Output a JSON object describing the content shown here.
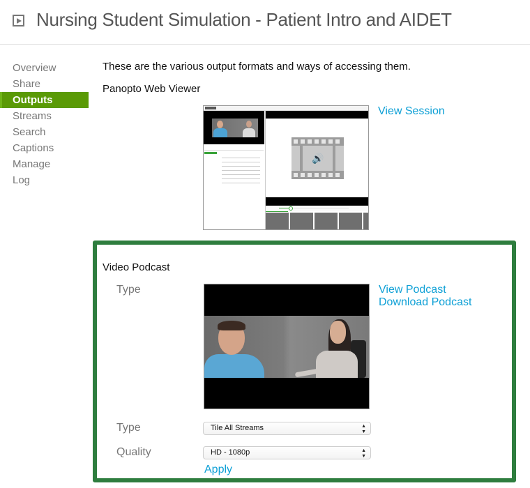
{
  "header": {
    "icon": "play-box-icon",
    "title": "Nursing Student Simulation - Patient Intro and AIDET"
  },
  "sidebar": {
    "items": [
      {
        "label": "Overview",
        "active": false
      },
      {
        "label": "Share",
        "active": false
      },
      {
        "label": "Outputs",
        "active": true
      },
      {
        "label": "Streams",
        "active": false
      },
      {
        "label": "Search",
        "active": false
      },
      {
        "label": "Captions",
        "active": false
      },
      {
        "label": "Manage",
        "active": false
      },
      {
        "label": "Log",
        "active": false
      }
    ]
  },
  "main": {
    "intro": "These are the various output formats and ways of accessing them.",
    "web_viewer": {
      "title": "Panopto Web Viewer",
      "thumbnail": "web-viewer-preview-image",
      "link": "View Session"
    },
    "video_podcast": {
      "title": "Video Podcast",
      "preview_label": "Type",
      "thumbnail": "podcast-video-preview-image",
      "links": {
        "view": "View Podcast",
        "download": "Download Podcast"
      },
      "type_field": {
        "label": "Type",
        "selected": "Tile All Streams"
      },
      "quality_field": {
        "label": "Quality",
        "selected": "HD - 1080p"
      },
      "apply_label": "Apply"
    }
  },
  "colors": {
    "accent_link": "#0ea0d6",
    "active_nav": "#5a9a06",
    "highlight_border": "#2e7d3e"
  }
}
